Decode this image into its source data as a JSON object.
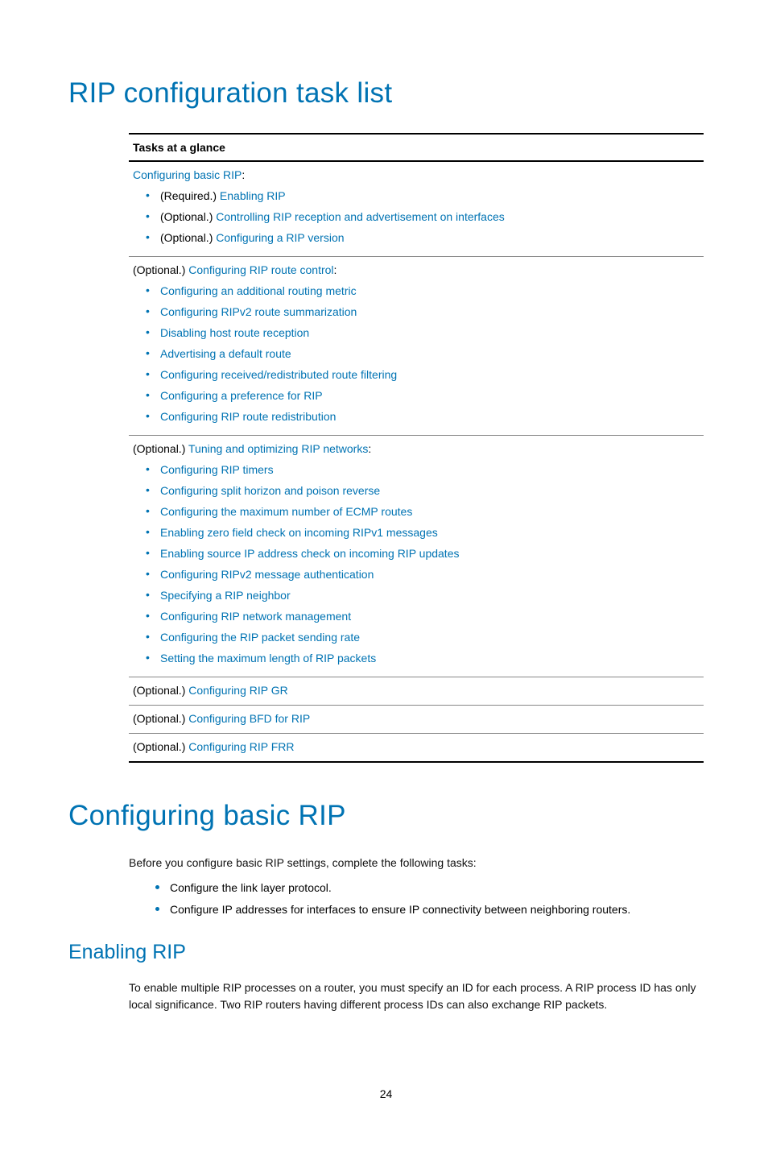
{
  "h1_a": "RIP configuration task list",
  "th": "Tasks at a glance",
  "s1": {
    "lead_link": "Configuring basic RIP",
    "items": [
      {
        "pfx": "(Required.) ",
        "link": "Enabling RIP"
      },
      {
        "pfx": "(Optional.) ",
        "link": "Controlling RIP reception and advertisement on interfaces"
      },
      {
        "pfx": "(Optional.) ",
        "link": "Configuring a RIP version"
      }
    ]
  },
  "s2": {
    "pfx": "(Optional.) ",
    "lead_link": "Configuring RIP route control",
    "items": [
      "Configuring an additional routing metric",
      "Configuring RIPv2 route summarization",
      "Disabling host route reception",
      "Advertising a default route",
      "Configuring received/redistributed route filtering",
      "Configuring a preference for RIP",
      "Configuring RIP route redistribution"
    ]
  },
  "s3": {
    "pfx": "(Optional.) ",
    "lead_link": "Tuning and optimizing RIP networks",
    "items": [
      "Configuring RIP timers",
      "Configuring split horizon and poison reverse",
      "Configuring the maximum number of ECMP routes",
      "Enabling zero field check on incoming RIPv1 messages",
      "Enabling source IP address check on incoming RIP updates",
      "Configuring RIPv2 message authentication",
      "Specifying a RIP neighbor",
      "Configuring RIP network management",
      "Configuring the RIP packet sending rate",
      "Setting the maximum length of RIP packets"
    ]
  },
  "o1": {
    "pfx": "(Optional.) ",
    "link": "Configuring RIP GR"
  },
  "o2": {
    "pfx": "(Optional.) ",
    "link": "Configuring BFD for RIP"
  },
  "o3": {
    "pfx": "(Optional.) ",
    "link": "Configuring RIP FRR"
  },
  "h1_b": "Configuring basic RIP",
  "p_intro": "Before you configure basic RIP settings, complete the following tasks:",
  "intro_items": [
    "Configure the link layer protocol.",
    "Configure IP addresses for interfaces to ensure IP connectivity between neighboring routers."
  ],
  "h2_a": "Enabling RIP",
  "p_enable": "To enable multiple RIP processes on a router, you must specify an ID for each process. A RIP process ID has only local significance. Two RIP routers having different process IDs can also exchange RIP packets.",
  "page": "24"
}
